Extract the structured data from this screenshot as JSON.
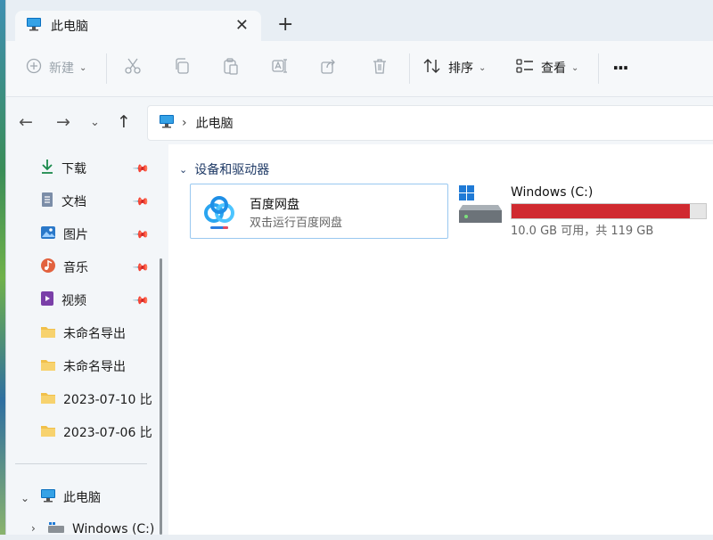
{
  "window": {
    "tab_title": "此电脑",
    "tab_close": "✕",
    "new_tab": "+"
  },
  "toolbar": {
    "new_label": "新建",
    "sort_label": "排序",
    "view_label": "查看",
    "more_label": "···"
  },
  "address": {
    "location": "此电脑"
  },
  "sidebar": {
    "pinned": [
      {
        "label": "下载",
        "icon": "download-icon"
      },
      {
        "label": "文档",
        "icon": "document-icon"
      },
      {
        "label": "图片",
        "icon": "picture-icon"
      },
      {
        "label": "音乐",
        "icon": "music-icon"
      },
      {
        "label": "视频",
        "icon": "video-icon"
      }
    ],
    "folders": [
      {
        "label": "未命名导出"
      },
      {
        "label": "未命名导出"
      },
      {
        "label": "2023-07-10 比"
      },
      {
        "label": "2023-07-06 比"
      }
    ],
    "this_pc": "此电脑",
    "drive": "Windows (C:)"
  },
  "main": {
    "group_header": "设备和驱动器",
    "baidu": {
      "title": "百度网盘",
      "subtitle": "双击运行百度网盘"
    },
    "drive": {
      "name": "Windows (C:)",
      "space": "10.0 GB 可用，共 119 GB",
      "used_fraction": 0.916,
      "bar_color": "#d02a30"
    }
  },
  "colors": {
    "accent": "#0067c0",
    "selected_border": "#99c8f0",
    "drive_full": "#d02a30"
  }
}
